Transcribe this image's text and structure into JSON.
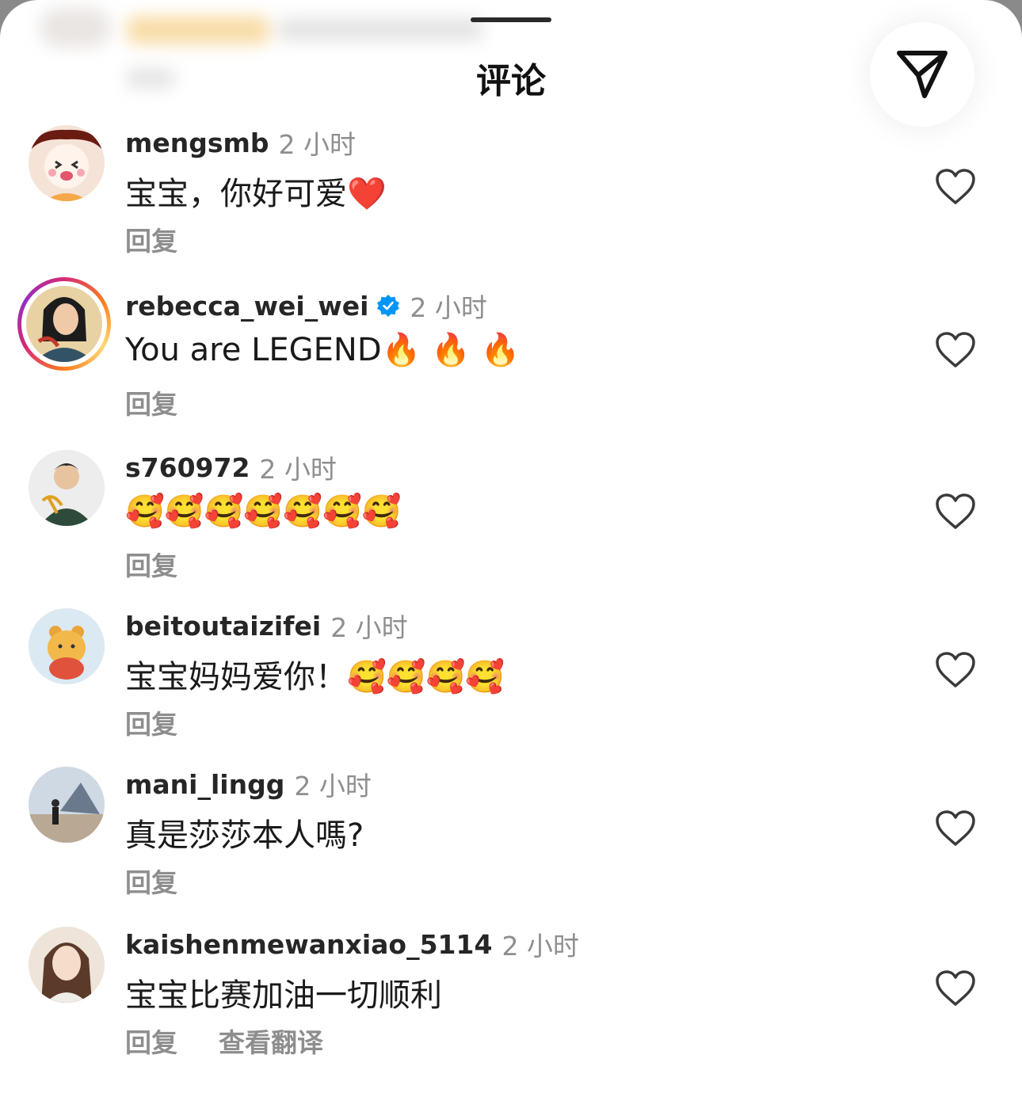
{
  "header": {
    "title": "评论"
  },
  "icons": {
    "share": "paper-plane-icon",
    "like": "heart-outline-icon",
    "verified": "verified-badge-icon"
  },
  "colors": {
    "username": "#262626",
    "secondary": "#8e8e8e",
    "verified": "#0095f6"
  },
  "comments": [
    {
      "username": "mengsmb",
      "time": "2 小时",
      "text": "宝宝，你好可爱❤️",
      "reply_label": "回复",
      "verified": false,
      "story_ring": false
    },
    {
      "username": "rebecca_wei_wei",
      "time": "2 小时",
      "text": "You are LEGEND🔥 🔥 🔥",
      "reply_label": "回复",
      "verified": true,
      "story_ring": true
    },
    {
      "username": "s760972",
      "time": "2 小时",
      "text": "🥰🥰🥰🥰🥰🥰🥰",
      "reply_label": "回复",
      "verified": false,
      "story_ring": false
    },
    {
      "username": "beitoutaizifei",
      "time": "2 小时",
      "text": "宝宝妈妈爱你！🥰🥰🥰🥰",
      "reply_label": "回复",
      "verified": false,
      "story_ring": false
    },
    {
      "username": "mani_lingg",
      "time": "2 小时",
      "text": "真是莎莎本人嗎?",
      "reply_label": "回复",
      "verified": false,
      "story_ring": false
    },
    {
      "username": "kaishenmewanxiao_5114",
      "time": "2 小时",
      "text": "宝宝比赛加油一切顺利",
      "reply_label": "回复",
      "translate_label": "查看翻译",
      "verified": false,
      "story_ring": false
    }
  ]
}
